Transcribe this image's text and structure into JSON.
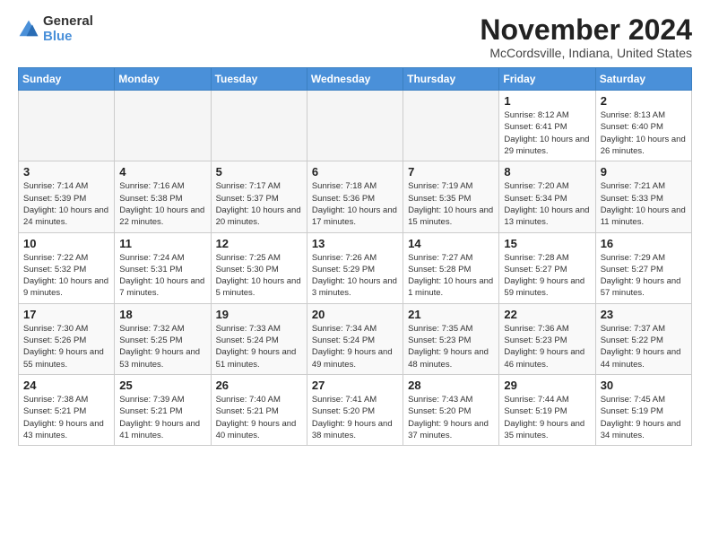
{
  "logo": {
    "general": "General",
    "blue": "Blue"
  },
  "header": {
    "month": "November 2024",
    "location": "McCordsville, Indiana, United States"
  },
  "days_of_week": [
    "Sunday",
    "Monday",
    "Tuesday",
    "Wednesday",
    "Thursday",
    "Friday",
    "Saturday"
  ],
  "weeks": [
    [
      {
        "day": "",
        "info": ""
      },
      {
        "day": "",
        "info": ""
      },
      {
        "day": "",
        "info": ""
      },
      {
        "day": "",
        "info": ""
      },
      {
        "day": "",
        "info": ""
      },
      {
        "day": "1",
        "info": "Sunrise: 8:12 AM\nSunset: 6:41 PM\nDaylight: 10 hours and 29 minutes."
      },
      {
        "day": "2",
        "info": "Sunrise: 8:13 AM\nSunset: 6:40 PM\nDaylight: 10 hours and 26 minutes."
      }
    ],
    [
      {
        "day": "3",
        "info": "Sunrise: 7:14 AM\nSunset: 5:39 PM\nDaylight: 10 hours and 24 minutes."
      },
      {
        "day": "4",
        "info": "Sunrise: 7:16 AM\nSunset: 5:38 PM\nDaylight: 10 hours and 22 minutes."
      },
      {
        "day": "5",
        "info": "Sunrise: 7:17 AM\nSunset: 5:37 PM\nDaylight: 10 hours and 20 minutes."
      },
      {
        "day": "6",
        "info": "Sunrise: 7:18 AM\nSunset: 5:36 PM\nDaylight: 10 hours and 17 minutes."
      },
      {
        "day": "7",
        "info": "Sunrise: 7:19 AM\nSunset: 5:35 PM\nDaylight: 10 hours and 15 minutes."
      },
      {
        "day": "8",
        "info": "Sunrise: 7:20 AM\nSunset: 5:34 PM\nDaylight: 10 hours and 13 minutes."
      },
      {
        "day": "9",
        "info": "Sunrise: 7:21 AM\nSunset: 5:33 PM\nDaylight: 10 hours and 11 minutes."
      }
    ],
    [
      {
        "day": "10",
        "info": "Sunrise: 7:22 AM\nSunset: 5:32 PM\nDaylight: 10 hours and 9 minutes."
      },
      {
        "day": "11",
        "info": "Sunrise: 7:24 AM\nSunset: 5:31 PM\nDaylight: 10 hours and 7 minutes."
      },
      {
        "day": "12",
        "info": "Sunrise: 7:25 AM\nSunset: 5:30 PM\nDaylight: 10 hours and 5 minutes."
      },
      {
        "day": "13",
        "info": "Sunrise: 7:26 AM\nSunset: 5:29 PM\nDaylight: 10 hours and 3 minutes."
      },
      {
        "day": "14",
        "info": "Sunrise: 7:27 AM\nSunset: 5:28 PM\nDaylight: 10 hours and 1 minute."
      },
      {
        "day": "15",
        "info": "Sunrise: 7:28 AM\nSunset: 5:27 PM\nDaylight: 9 hours and 59 minutes."
      },
      {
        "day": "16",
        "info": "Sunrise: 7:29 AM\nSunset: 5:27 PM\nDaylight: 9 hours and 57 minutes."
      }
    ],
    [
      {
        "day": "17",
        "info": "Sunrise: 7:30 AM\nSunset: 5:26 PM\nDaylight: 9 hours and 55 minutes."
      },
      {
        "day": "18",
        "info": "Sunrise: 7:32 AM\nSunset: 5:25 PM\nDaylight: 9 hours and 53 minutes."
      },
      {
        "day": "19",
        "info": "Sunrise: 7:33 AM\nSunset: 5:24 PM\nDaylight: 9 hours and 51 minutes."
      },
      {
        "day": "20",
        "info": "Sunrise: 7:34 AM\nSunset: 5:24 PM\nDaylight: 9 hours and 49 minutes."
      },
      {
        "day": "21",
        "info": "Sunrise: 7:35 AM\nSunset: 5:23 PM\nDaylight: 9 hours and 48 minutes."
      },
      {
        "day": "22",
        "info": "Sunrise: 7:36 AM\nSunset: 5:23 PM\nDaylight: 9 hours and 46 minutes."
      },
      {
        "day": "23",
        "info": "Sunrise: 7:37 AM\nSunset: 5:22 PM\nDaylight: 9 hours and 44 minutes."
      }
    ],
    [
      {
        "day": "24",
        "info": "Sunrise: 7:38 AM\nSunset: 5:21 PM\nDaylight: 9 hours and 43 minutes."
      },
      {
        "day": "25",
        "info": "Sunrise: 7:39 AM\nSunset: 5:21 PM\nDaylight: 9 hours and 41 minutes."
      },
      {
        "day": "26",
        "info": "Sunrise: 7:40 AM\nSunset: 5:21 PM\nDaylight: 9 hours and 40 minutes."
      },
      {
        "day": "27",
        "info": "Sunrise: 7:41 AM\nSunset: 5:20 PM\nDaylight: 9 hours and 38 minutes."
      },
      {
        "day": "28",
        "info": "Sunrise: 7:43 AM\nSunset: 5:20 PM\nDaylight: 9 hours and 37 minutes."
      },
      {
        "day": "29",
        "info": "Sunrise: 7:44 AM\nSunset: 5:19 PM\nDaylight: 9 hours and 35 minutes."
      },
      {
        "day": "30",
        "info": "Sunrise: 7:45 AM\nSunset: 5:19 PM\nDaylight: 9 hours and 34 minutes."
      }
    ]
  ]
}
